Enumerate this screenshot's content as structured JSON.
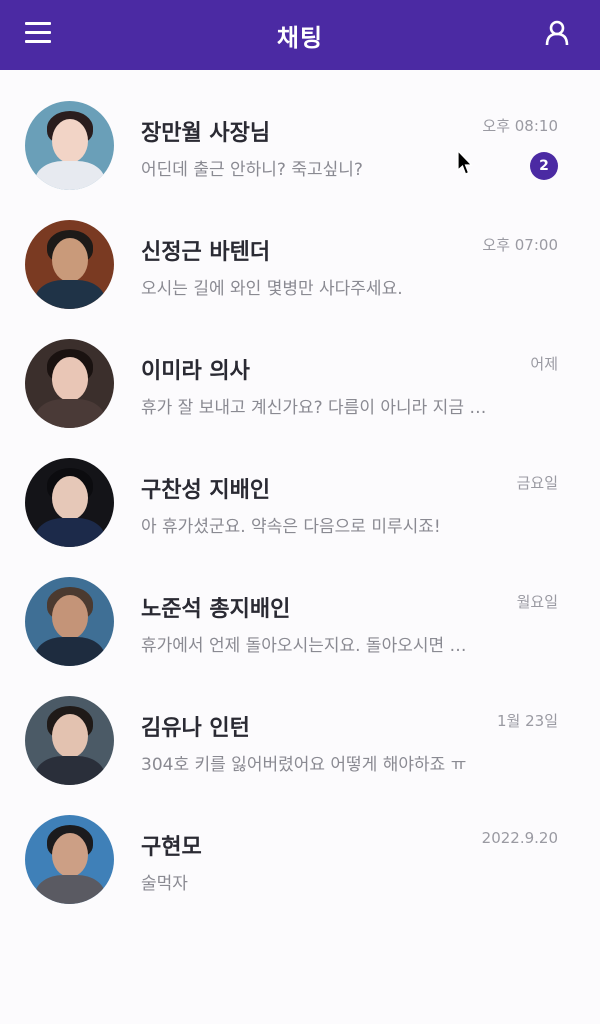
{
  "header": {
    "title": "채팅",
    "background": "#4b2aa3",
    "menu_icon": "menu-icon",
    "profile_icon": "person-icon"
  },
  "chats": [
    {
      "name": "장만월 사장님",
      "preview": "어딘데 출근 안하니? 죽고싶니?",
      "time": "오후 08:10",
      "unread": "2"
    },
    {
      "name": "신정근 바텐더",
      "preview": "오시는 길에 와인 몇병만 사다주세요.",
      "time": "오후 07:00"
    },
    {
      "name": "이미라 의사",
      "preview": "휴가 잘 보내고 계신가요? 다름이 아니라 지금 …",
      "time": "어제"
    },
    {
      "name": "구찬성 지배인",
      "preview": "아 휴가셨군요. 약속은 다음으로 미루시죠!",
      "time": "금요일"
    },
    {
      "name": "노준석 총지배인",
      "preview": "휴가에서 언제 돌아오시는지요. 돌아오시면 …",
      "time": "월요일"
    },
    {
      "name": "김유나 인턴",
      "preview": "304호 키를 잃어버렸어요 어떻게 해야하죠 ㅠ",
      "time": "1월 23일"
    },
    {
      "name": "구현모",
      "preview": "술먹자",
      "time": "2022.9.20"
    }
  ]
}
